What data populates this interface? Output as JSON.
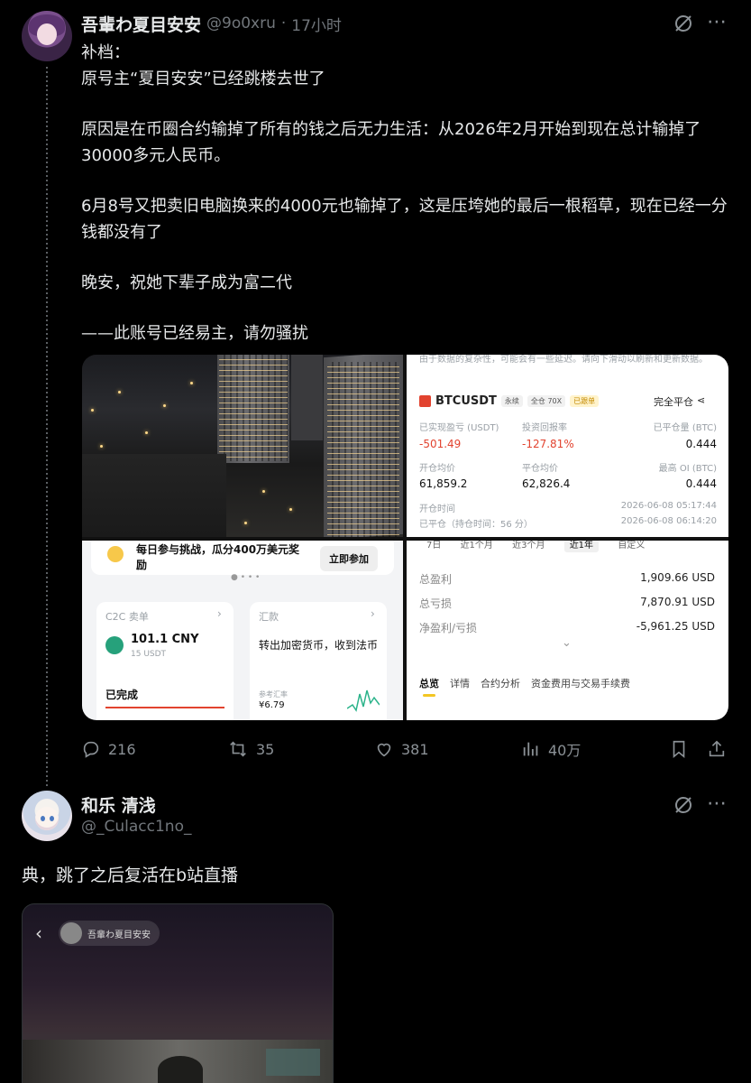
{
  "tweet1": {
    "display_name": "吾輩わ夏目安安",
    "handle": "@9o0xru",
    "separator": "·",
    "time": "17小时",
    "lines": [
      "补档：",
      "原号主“夏目安安”已经跳楼去世了",
      "",
      "原因是在币圈合约输掉了所有的钱之后无力生活：从2026年2月开始到现在总计输掉了30000多元人民币。",
      "",
      "6月8号又把卖旧电脑换来的4000元也输掉了，这是压垮她的最后一根稻草，现在已经一分钱都没有了",
      "",
      "晚安，祝她下辈子成为富二代",
      "",
      "——此账号已经易主，请勿骚扰"
    ],
    "actions": {
      "replies": "216",
      "retweets": "35",
      "likes": "381",
      "views": "40万"
    }
  },
  "btc_panel": {
    "notice": "由于数据的复杂性，可能会有一些延迟。请向下滑动以刷新和更新数据。",
    "symbol": "BTCUSDT",
    "tag_perp": "永续",
    "tag_leverage": "全仓 70X",
    "tag_copy": "已跟单",
    "action_close": "完全平仓",
    "labels": {
      "realized": "已实现盈亏 (USDT)",
      "roi": "投资回报率",
      "closed_qty": "已平仓量 (BTC)",
      "open_avg": "开仓均价",
      "close_avg": "平仓均价",
      "max_oi": "最高 OI (BTC)",
      "open_time": "开仓时间",
      "closed": "已平仓（持仓时间：56 分）"
    },
    "values": {
      "realized": "-501.49",
      "roi": "-127.81%",
      "closed_qty": "0.444",
      "open_avg": "61,859.2",
      "close_avg": "62,826.4",
      "max_oi": "0.444",
      "open_time": "2026-06-08 05:17:44",
      "close_time": "2026-06-08 06:14:20"
    }
  },
  "wallet_panel": {
    "promo": "每日参与挑战，瓜分400万美元奖励",
    "join": "立即参加",
    "c2c_title": "C2C 卖单",
    "c2c_amount": "101.1 CNY",
    "c2c_usdt": "15 USDT",
    "c2c_status": "已完成",
    "remit_title": "汇款",
    "remit_desc": "转出加密货币，收到法币",
    "ref_rate_label": "参考汇率",
    "ref_rate": "¥6.79"
  },
  "pnl_panel": {
    "ranges": [
      "7日",
      "近1个月",
      "近3个月",
      "近1年",
      "自定义"
    ],
    "active_range": "近1年",
    "rows": [
      {
        "label": "总盈利",
        "value": "1,909.66 USD"
      },
      {
        "label": "总亏损",
        "value": "7,870.91 USD"
      },
      {
        "label": "净盈利/亏损",
        "value": "-5,961.25 USD"
      }
    ],
    "bottom_tabs": [
      "总览",
      "详情",
      "合约分析",
      "资金费用与交易手续费"
    ]
  },
  "tweet2": {
    "display_name": "和乐 清浅",
    "handle": "@_Culacc1no_",
    "text": "典，跳了之后复活在b站直播",
    "video_channel": "吾輩わ夏目安安"
  },
  "colors": {
    "background": "#000000",
    "text": "#e7e9ea",
    "muted": "#71767b",
    "loss_red": "#e2432f"
  }
}
